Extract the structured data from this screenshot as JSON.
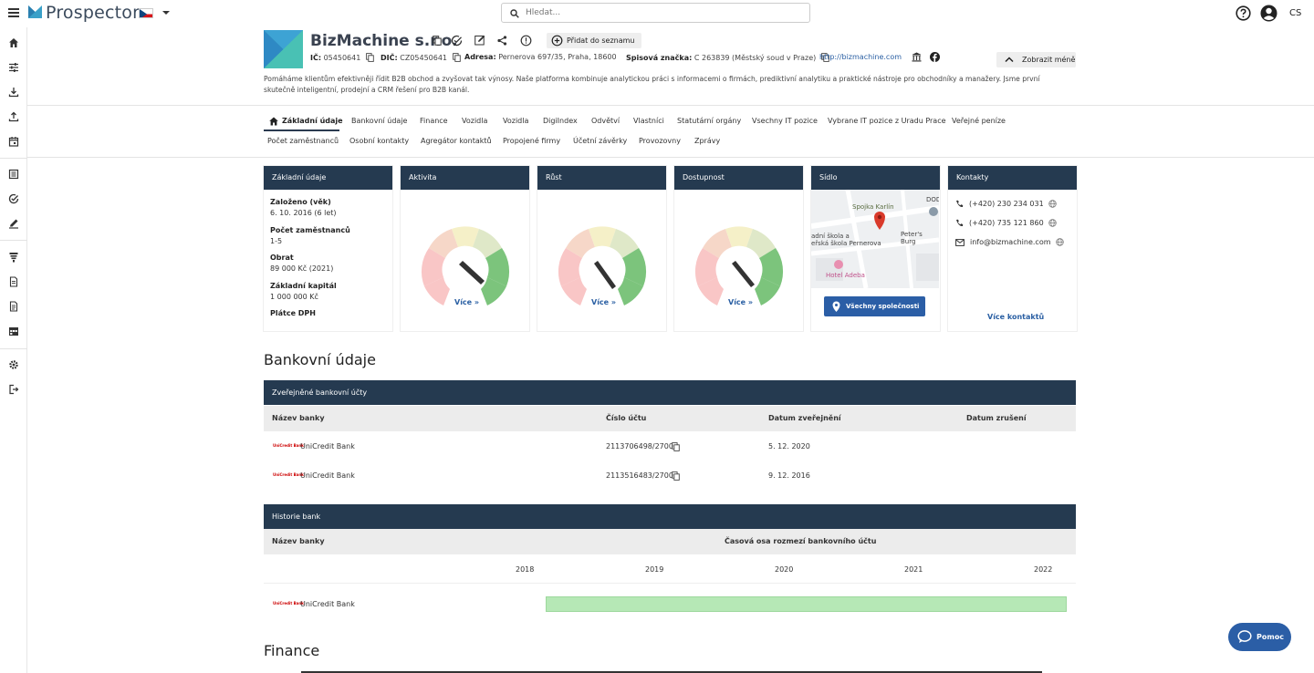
{
  "app": {
    "logo_text": "Prospector",
    "search_placeholder": "Hledat...",
    "lang": "CS"
  },
  "company": {
    "name": "BizMachine s.r.o.",
    "add_to_list": "Přidat do seznamu",
    "ico_label": "IČ:",
    "ico": "05450641",
    "dic_label": "DIČ:",
    "dic": "CZ05450641",
    "address_label": "Adresa:",
    "address": "Pernerova 697/35, Praha, 18600",
    "file_label": "Spisová značka:",
    "file_no": "C 263839 (Městský soud v Praze)",
    "website": "http://bizmachine.com",
    "show_less": "Zobrazit méně",
    "description": "Pomáháme klientům efektivněji řídit B2B obchod a zvyšovat tak výnosy. Naše platforma kombinuje analytickou práci s informacemi o firmách, prediktivní analytiku a praktické nástroje pro obchodníky a manažery. Jsme první skutečně inteligentní, prodejní a CRM řešení pro B2B kanál."
  },
  "tabs_row1": [
    "Základní údaje",
    "Bankovní údaje",
    "Finance",
    "Vozidla",
    "Vozidla",
    "DigiIndex",
    "Odvětví",
    "Vlastníci",
    "Statutární orgány",
    "Vsechny IT pozice",
    "Vybrane IT pozice z Uradu Prace",
    "Veřejné peníze"
  ],
  "tabs_row2": [
    "Počet zaměstnanců",
    "Osobní kontakty",
    "Agregátor kontaktů",
    "Propojené firmy",
    "Účetní závěrky",
    "Provozovny",
    "Zprávy"
  ],
  "cards": {
    "basic": {
      "title": "Základní údaje",
      "founded_label": "Založeno (věk)",
      "founded": "6. 10. 2016 (6 let)",
      "employees_label": "Počet zaměstnanců",
      "employees": "1-5",
      "revenue_label": "Obrat",
      "revenue": "89 000 Kč (2021)",
      "capital_label": "Základní kapitál",
      "capital": "1 000 000 Kč",
      "vat_label": "Plátce DPH"
    },
    "activity": {
      "title": "Aktivita",
      "more": "Více »"
    },
    "growth": {
      "title": "Růst",
      "more": "Více »"
    },
    "availability": {
      "title": "Dostupnost",
      "more": "Více »"
    },
    "seat": {
      "title": "Sídlo",
      "map_labels": [
        "Spojka Karlín",
        "adní škola a",
        "eřská škola Pernerova",
        "Peter's Burg",
        "Hotel Adeba",
        "DOD"
      ],
      "all_companies": "Všechny společnosti (64)"
    },
    "contacts": {
      "title": "Kontakty",
      "phone1": "(+420) 230 234 031",
      "phone2": "(+420) 735 121 860",
      "email": "info@bizmachine.com",
      "more": "Více kontaktů"
    }
  },
  "bank": {
    "section_title": "Bankovní údaje",
    "published_title": "Zveřejněné bankovní účty",
    "col_bank": "Název banky",
    "col_account": "Číslo účtu",
    "col_published": "Datum zveřejnění",
    "col_cancelled": "Datum zrušení",
    "rows": [
      {
        "logo": "UniCredit Bank",
        "bank": "UniCredit Bank",
        "account": "2113706498/2700",
        "published": "5. 12. 2020",
        "cancelled": ""
      },
      {
        "logo": "UniCredit Bank",
        "bank": "UniCredit Bank",
        "account": "2113516483/2700",
        "published": "9. 12. 2016",
        "cancelled": ""
      }
    ],
    "history_title": "Historie bank",
    "history_col_bank": "Název banky",
    "history_col_timeline": "Časová osa rozmezí bankovního účtu",
    "years": [
      "2018",
      "2019",
      "2020",
      "2021",
      "2022"
    ],
    "history_row": {
      "logo": "UniCredit Bank",
      "bank": "UniCredit Bank"
    }
  },
  "finance": {
    "section_title": "Finance"
  },
  "help": {
    "label": "Pomoc"
  }
}
